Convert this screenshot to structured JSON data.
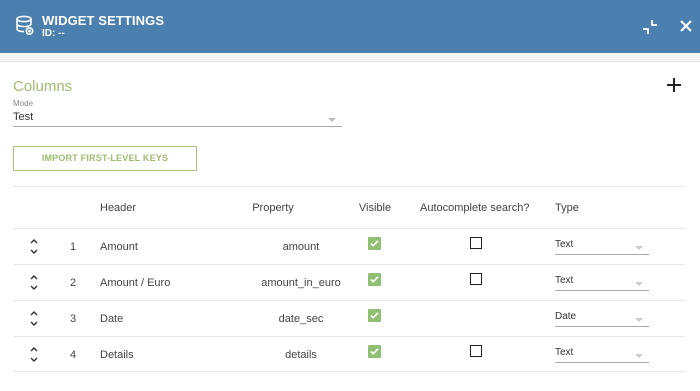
{
  "header": {
    "title": "WIDGET SETTINGS",
    "subtitle": "ID: --",
    "icon": "database-icon",
    "minimize_icon": "minimize-icon",
    "close_icon": "close-icon",
    "color": "#4a7fae"
  },
  "section": {
    "title": "Columns",
    "add_icon": "plus-icon",
    "accent_color": "#9ebc6f"
  },
  "mode": {
    "label": "Mode",
    "value": "Test"
  },
  "import_button": {
    "label": "IMPORT FIRST-LEVEL KEYS"
  },
  "table": {
    "columns": [
      "Header",
      "Property",
      "Visible",
      "Autocomplete search?",
      "Type"
    ],
    "rows": [
      {
        "index": "1",
        "header": "Amount",
        "property": "amount",
        "visible": true,
        "autocomplete": false,
        "type": "Text"
      },
      {
        "index": "2",
        "header": "Amount / Euro",
        "property": "amount_in_euro",
        "visible": true,
        "autocomplete": false,
        "type": "Text"
      },
      {
        "index": "3",
        "header": "Date",
        "property": "date_sec",
        "visible": true,
        "autocomplete": null,
        "type": "Date"
      },
      {
        "index": "4",
        "header": "Details",
        "property": "details",
        "visible": true,
        "autocomplete": false,
        "type": "Text"
      }
    ]
  }
}
